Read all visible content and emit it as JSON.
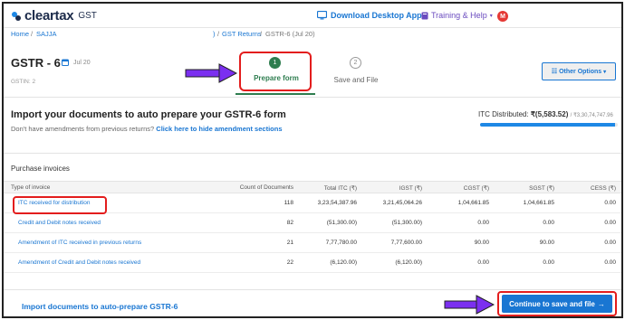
{
  "brand": {
    "name": "cleartax",
    "suffix": "GST"
  },
  "topbar": {
    "download_label": "Download Desktop App",
    "help_label": "Training & Help",
    "avatar_initial": "M"
  },
  "breadcrumb": {
    "home": "Home",
    "separator_1": "/",
    "business": "SAJJA",
    "trail_start": ")",
    "separator_2": "/",
    "gst_returns": "GST Returns",
    "separator_3": "/",
    "current": "GSTR-6 (Jul 20)"
  },
  "header": {
    "title": "GSTR - 6",
    "period": "Jul 20",
    "gstin": "GSTIN: 2"
  },
  "steps": [
    {
      "number": "1",
      "label": "Prepare form",
      "active": true
    },
    {
      "number": "2",
      "label": "Save and File",
      "active": false
    }
  ],
  "other_options_label": "Other Options",
  "import_section": {
    "title": "Import your documents to auto prepare your GSTR-6 form",
    "subtitle": "Don't have amendments from previous returns?",
    "subtitle_link": "Click here to hide amendment sections",
    "itc_label": "ITC Distributed:",
    "itc_distributed": "₹(5,583.52)",
    "itc_total": "/ ₹3,30,74,747.96",
    "progress_fraction": 0.98
  },
  "purchase_invoices": {
    "label": "Purchase invoices",
    "columns": [
      "Type of invoice",
      "Count of Documents",
      "Total ITC (₹)",
      "IGST (₹)",
      "CGST (₹)",
      "SGST (₹)",
      "CESS (₹)"
    ],
    "rows": [
      {
        "type": "ITC received for distribution",
        "count": "118",
        "total_itc": "3,23,54,387.96",
        "igst": "3,21,45,064.26",
        "cgst": "1,04,661.85",
        "sgst": "1,04,661.85",
        "cess": "0.00"
      },
      {
        "type": "Credit and Debit notes received",
        "count": "82",
        "total_itc": "(51,300.00)",
        "igst": "(51,300.00)",
        "cgst": "0.00",
        "sgst": "0.00",
        "cess": "0.00"
      },
      {
        "type": "Amendment of ITC received in previous returns",
        "count": "21",
        "total_itc": "7,77,780.00",
        "igst": "7,77,600.00",
        "cgst": "90.00",
        "sgst": "90.00",
        "cess": "0.00"
      },
      {
        "type": "Amendment of Credit and Debit notes received",
        "count": "22",
        "total_itc": "(6,120.00)",
        "igst": "(6,120.00)",
        "cgst": "0.00",
        "sgst": "0.00",
        "cess": "0.00"
      }
    ]
  },
  "footer": {
    "import_link": "Import documents to auto-prepare GSTR-6",
    "continue_label": "Continue to save and file",
    "continue_arrow": "→"
  },
  "colors": {
    "brand_blue": "#1976d2",
    "step_green": "#2e7d4f",
    "highlight_red": "#e31d1d",
    "annotation_purple": "#7b2ff0"
  }
}
